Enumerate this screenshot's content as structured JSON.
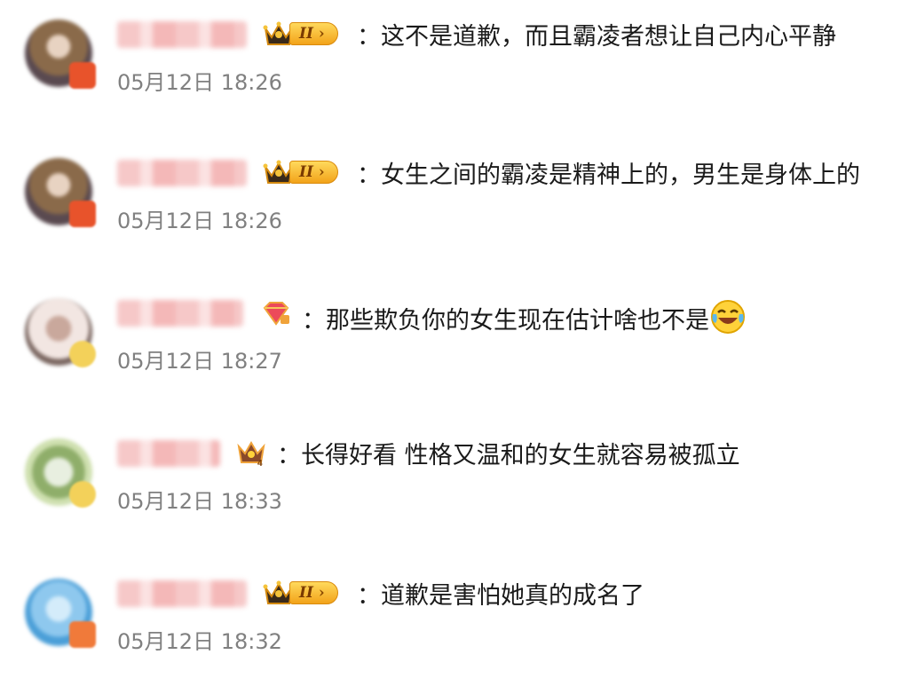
{
  "comments": [
    {
      "badge_type": "crown-level",
      "level": "II",
      "separator": "：",
      "text": "这不是道歉，而且霸凌者想让自己内心平静",
      "timestamp": "05月12日 18:26",
      "avatar_colors": [
        "#8a6a4a",
        "#e8d3c2",
        "#5a4a50"
      ],
      "badge_color": "#e8532b"
    },
    {
      "badge_type": "crown-level",
      "level": "II",
      "separator": "：",
      "text": "女生之间的霸凌是精神上的，男生是身体上的",
      "timestamp": "05月12日 18:26",
      "avatar_colors": [
        "#8a6a4a",
        "#e8d3c2",
        "#5a4a50"
      ],
      "badge_color": "#e8532b"
    },
    {
      "badge_type": "gem-crown",
      "separator": "：",
      "text": "那些欺负你的女生现在估计啥也不是",
      "emoji": "laugh-cry-emoji",
      "timestamp": "05月12日 18:27",
      "avatar_colors": [
        "#f2e6e2",
        "#c9a89c",
        "#7a6660"
      ],
      "badge_color": "#f3d15a"
    },
    {
      "badge_type": "gem-crown-4",
      "separator": "：",
      "text": "长得好看 性格又温和的女生就容易被孤立",
      "timestamp": "05月12日 18:33",
      "avatar_colors": [
        "#cfe0b0",
        "#8fae6a",
        "#e8efe0"
      ],
      "badge_color": "#f3d15a"
    },
    {
      "badge_type": "crown-level",
      "level": "II",
      "separator": "：",
      "text": "道歉是害怕她真的成名了",
      "timestamp": "05月12日 18:32",
      "avatar_colors": [
        "#8ec8ee",
        "#4b9fd8",
        "#d4ecfa"
      ],
      "badge_color": "#f07a3a"
    }
  ]
}
